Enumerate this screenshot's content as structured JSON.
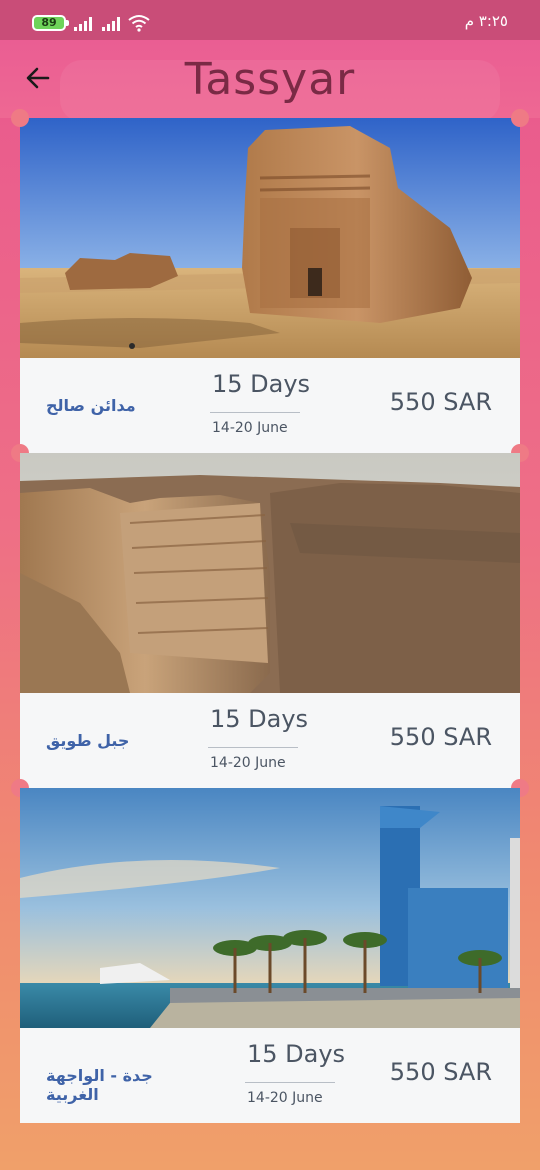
{
  "status": {
    "battery": "89",
    "time": "٣:٢٥ م"
  },
  "header": {
    "title": "Tassyar",
    "back_icon": "arrow-back-icon"
  },
  "colors": {
    "gradient_top": "#e9578f",
    "gradient_bottom": "#f0a06a",
    "title": "#7a2a45",
    "place_text": "#3f63a8",
    "card_bg": "#f6f7f8"
  },
  "trips": [
    {
      "place": "مدائن صالح",
      "days": "15 Days",
      "dates": "14-20 June",
      "price": "550 SAR",
      "image": "madain-saleh-rock-tomb"
    },
    {
      "place": "جبل طويق",
      "days": "15 Days",
      "dates": "14-20 June",
      "price": "550 SAR",
      "image": "tuwaiq-cliffs"
    },
    {
      "place": "جدة - الواجهة الغربية",
      "days": "15 Days",
      "dates": "14-20 June",
      "price": "550 SAR",
      "image": "jeddah-waterfront"
    }
  ]
}
